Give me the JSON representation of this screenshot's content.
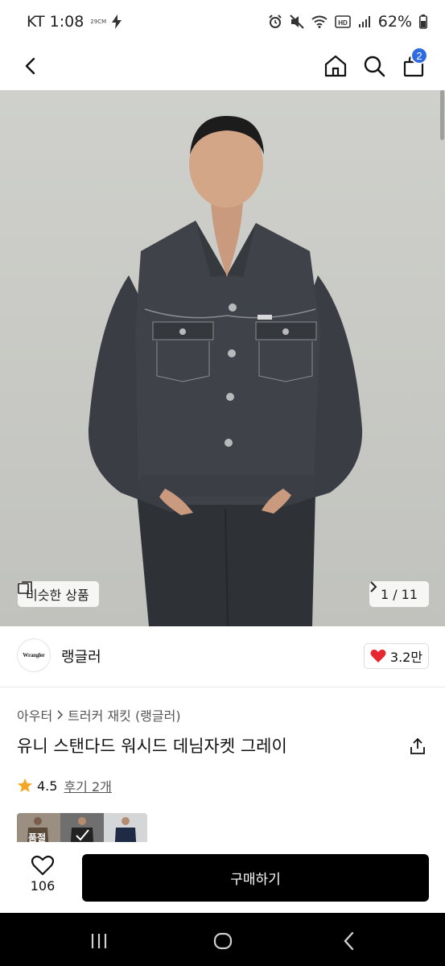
{
  "status_bar": {
    "carrier_time": "KT 1:08",
    "small_label": "29CM",
    "battery": "62%"
  },
  "nav": {
    "cart_count": "2"
  },
  "gallery": {
    "similar_label": "비슷한 상품",
    "counter": "1 / 11"
  },
  "brand": {
    "logo_text": "Wrangler",
    "name": "랭글러",
    "likes": "3.2만"
  },
  "product": {
    "breadcrumb": [
      "아우터",
      "트러커 재킷 (랭글러)"
    ],
    "title": "유니 스탠다드 워시드 데님자켓 그레이",
    "rating": "4.5",
    "review_label": "후기 2개",
    "thumb_label": "품절"
  },
  "bottom_bar": {
    "wish_count": "106",
    "buy_label": "구매하기"
  },
  "colors": {
    "accent_badge": "#2f6be0",
    "heart": "#e8262f",
    "star": "#f5a623",
    "buy_button": "#000000"
  },
  "icons": [
    "back-arrow-icon",
    "home-icon",
    "search-icon",
    "shopping-bag-icon",
    "similar-items-icon",
    "chevron-right-icon",
    "heart-icon",
    "share-icon",
    "star-icon",
    "heart-outline-icon",
    "recent-apps-icon",
    "home-circle-icon",
    "system-back-icon"
  ]
}
